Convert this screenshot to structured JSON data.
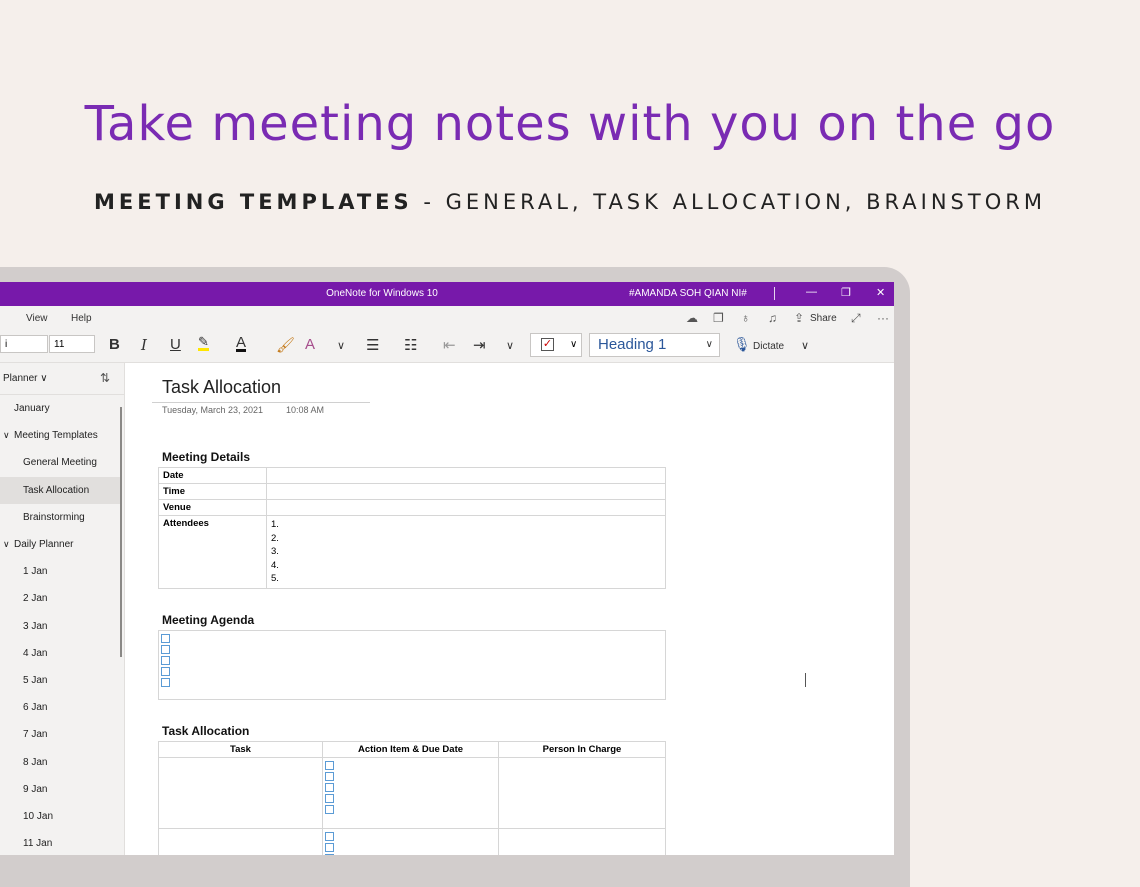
{
  "headline": "Take meeting notes with you on the go",
  "subline": {
    "bold": "MEETING TEMPLATES",
    "rest": " - GENERAL, TASK ALLOCATION, BRAINSTORM"
  },
  "window": {
    "title": "OneNote for Windows 10",
    "account": "#AMANDA SOH QIAN NI#",
    "controls": [
      "—",
      "❐",
      "✕"
    ]
  },
  "menu": {
    "items": [
      "View",
      "Help"
    ],
    "share_label": "Share",
    "more": "···"
  },
  "ribbon": {
    "font_name": "i",
    "font_size": "11",
    "bold": "B",
    "italic": "I",
    "underline": "U",
    "font_color_letter": "A",
    "style_value": "Heading 1",
    "dictate_label": "Dictate"
  },
  "sidebar": {
    "header": "Planner",
    "items": [
      {
        "label": "January",
        "indent": 14,
        "arrow": ""
      },
      {
        "label": "Meeting Templates",
        "indent": 14,
        "arrow": "∨"
      },
      {
        "label": "General Meeting",
        "indent": 23,
        "arrow": ""
      },
      {
        "label": "Task Allocation",
        "indent": 23,
        "arrow": "",
        "selected": true
      },
      {
        "label": "Brainstorming",
        "indent": 23,
        "arrow": ""
      },
      {
        "label": "Daily Planner",
        "indent": 14,
        "arrow": "∨"
      },
      {
        "label": "1 Jan",
        "indent": 23,
        "arrow": ""
      },
      {
        "label": "2 Jan",
        "indent": 23,
        "arrow": ""
      },
      {
        "label": "3 Jan",
        "indent": 23,
        "arrow": ""
      },
      {
        "label": "4 Jan",
        "indent": 23,
        "arrow": ""
      },
      {
        "label": "5 Jan",
        "indent": 23,
        "arrow": ""
      },
      {
        "label": "6 Jan",
        "indent": 23,
        "arrow": ""
      },
      {
        "label": "7 Jan",
        "indent": 23,
        "arrow": ""
      },
      {
        "label": "8 Jan",
        "indent": 23,
        "arrow": ""
      },
      {
        "label": "9 Jan",
        "indent": 23,
        "arrow": ""
      },
      {
        "label": "10 Jan",
        "indent": 23,
        "arrow": ""
      },
      {
        "label": "11 Jan",
        "indent": 23,
        "arrow": ""
      }
    ]
  },
  "page": {
    "title": "Task Allocation",
    "date": "Tuesday, March 23, 2021",
    "time": "10:08 AM",
    "details": {
      "heading": "Meeting Details",
      "rows": [
        {
          "label": "Date",
          "value": ""
        },
        {
          "label": "Time",
          "value": ""
        },
        {
          "label": "Venue",
          "value": ""
        }
      ],
      "attendees_label": "Attendees",
      "attendees": [
        "1.",
        "2.",
        "3.",
        "4.",
        "5."
      ]
    },
    "agenda": {
      "heading": "Meeting Agenda",
      "checkbox_count": 5
    },
    "tasks": {
      "heading": "Task Allocation",
      "columns": [
        "Task",
        "Action Item & Due Date",
        "Person In Charge"
      ]
    }
  },
  "colors": {
    "brand": "#7719aa",
    "headline": "#7a2bb3",
    "background": "#f5efeb"
  }
}
